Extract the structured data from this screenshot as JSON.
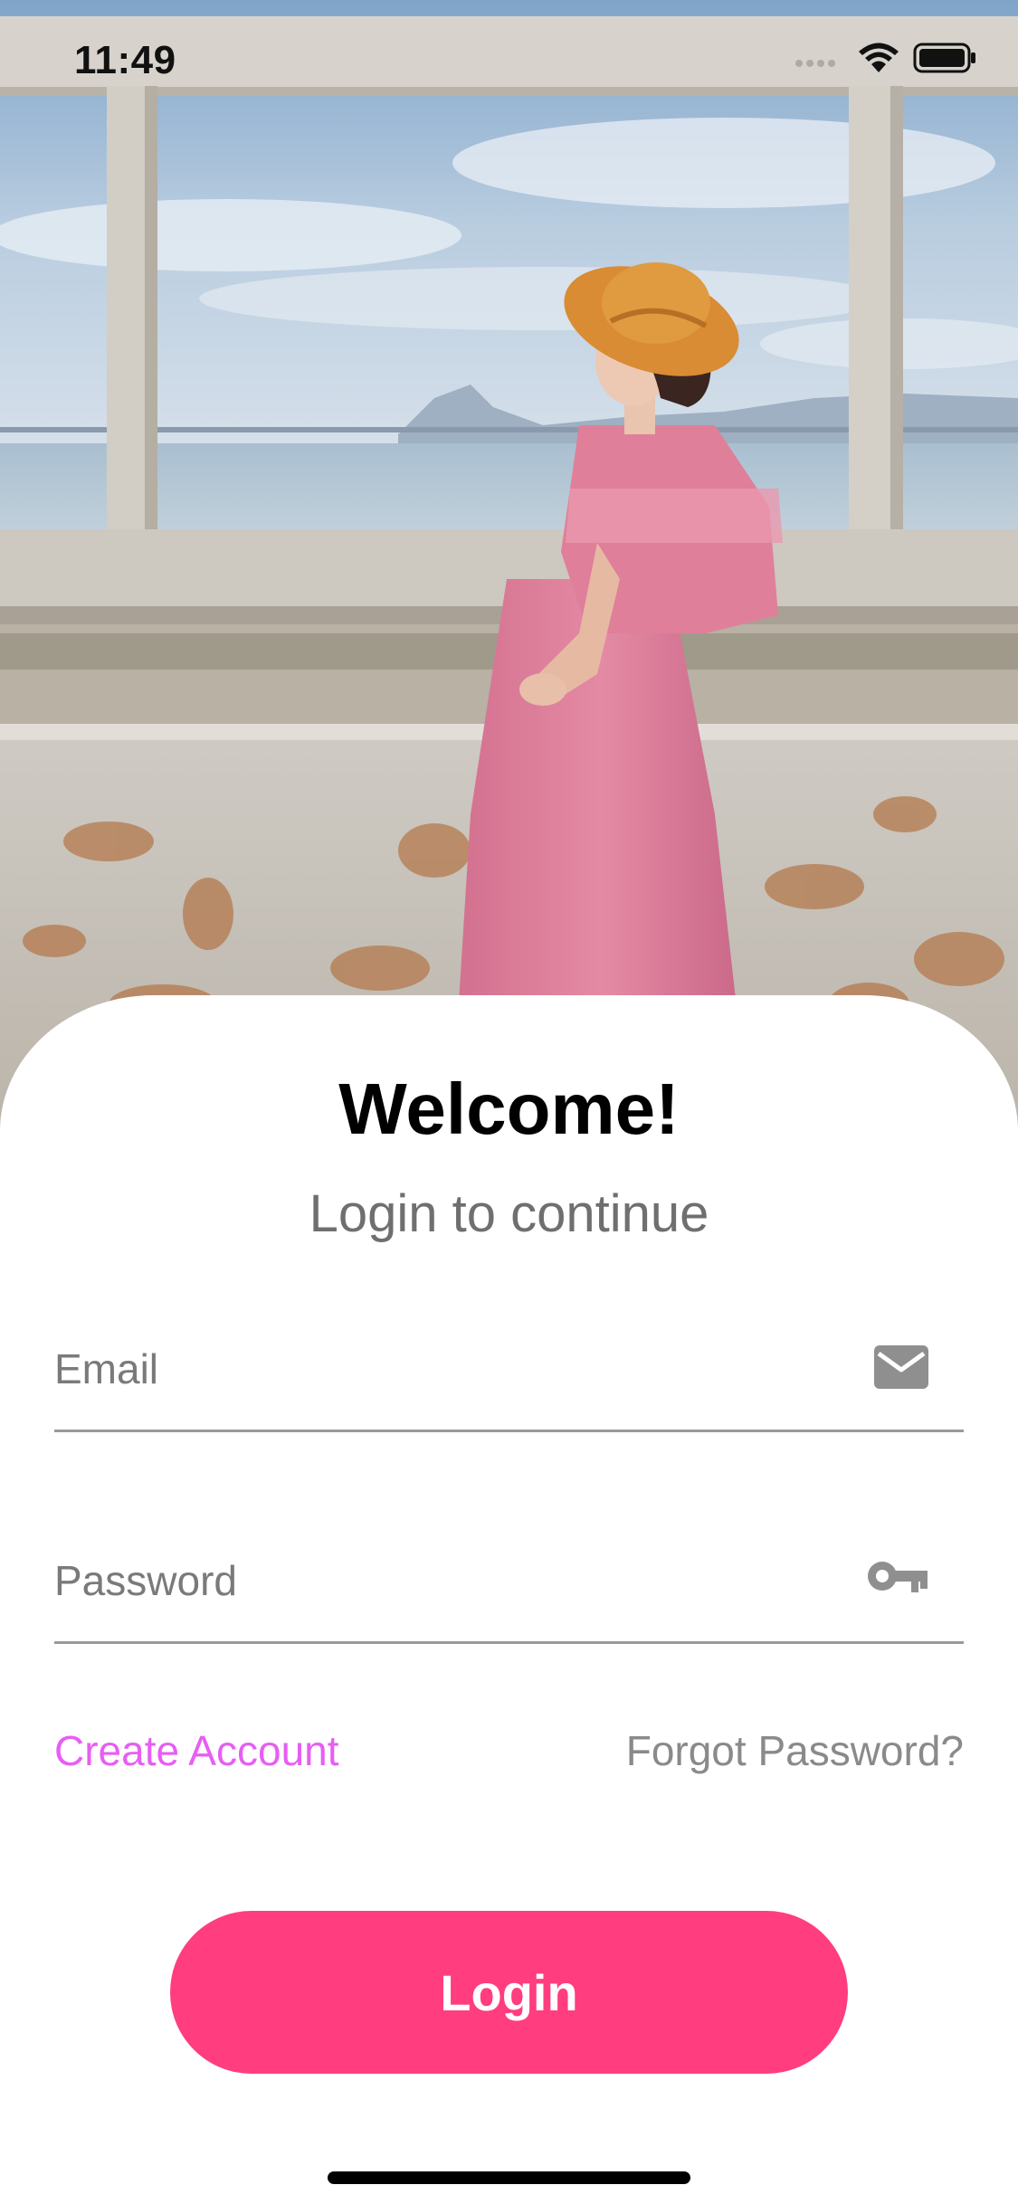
{
  "status_bar": {
    "time": "11:49",
    "icons": [
      "cellular-signal-icon",
      "wifi-icon",
      "battery-icon"
    ]
  },
  "hero": {
    "image": "photo of a woman in a pink dress and straw hat sitting on a weathered concrete wall by the sea"
  },
  "login": {
    "title": "Welcome!",
    "subtitle": "Login to continue",
    "email_placeholder": "Email",
    "email_icon": "mail-icon",
    "password_placeholder": "Password",
    "password_icon": "key-icon",
    "create_account_label": "Create Account",
    "forgot_password_label": "Forgot Password?",
    "login_button_label": "Login"
  },
  "colors": {
    "accent": "#ff3d7f",
    "link_accent": "#e75ef4",
    "muted_text": "#6f6f6f",
    "divider": "#9a9a9a"
  }
}
